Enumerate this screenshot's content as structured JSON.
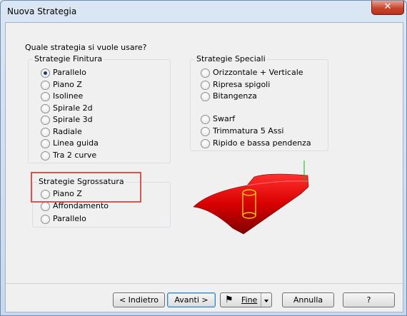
{
  "window": {
    "title": "Nuova Strategia",
    "close_glyph": "✕"
  },
  "question": "Quale strategia si vuole usare?",
  "finitura": {
    "legend": "Strategie Finitura",
    "options": [
      "Parallelo",
      "Piano Z",
      "Isolinee",
      "Spirale 2d",
      "Spirale 3d",
      "Radiale",
      "Linea guida",
      "Tra 2 curve"
    ],
    "selected": "Parallelo"
  },
  "speciali": {
    "legend": "Strategie Speciali",
    "options": [
      "Orizzontale + Verticale",
      "Ripresa spigoli",
      "Bitangenza",
      "Swarf",
      "Trimmatura 5 Assi",
      "Ripido e bassa pendenza"
    ]
  },
  "sgrossatura": {
    "legend": "Strategie Sgrossatura",
    "options": [
      "Piano Z",
      "Affondamento",
      "Parallelo"
    ]
  },
  "preview": {
    "icon": "3d-toolpath-preview",
    "colors": {
      "surface": "#e00000",
      "tool": "#ffee00",
      "axis": "#00c000"
    }
  },
  "buttons": {
    "back": "< Indietro",
    "next": "Avanti >",
    "finish": "Fine",
    "cancel": "Annulla",
    "help": "?"
  },
  "icons": {
    "finish": "checkered-flag-icon"
  }
}
